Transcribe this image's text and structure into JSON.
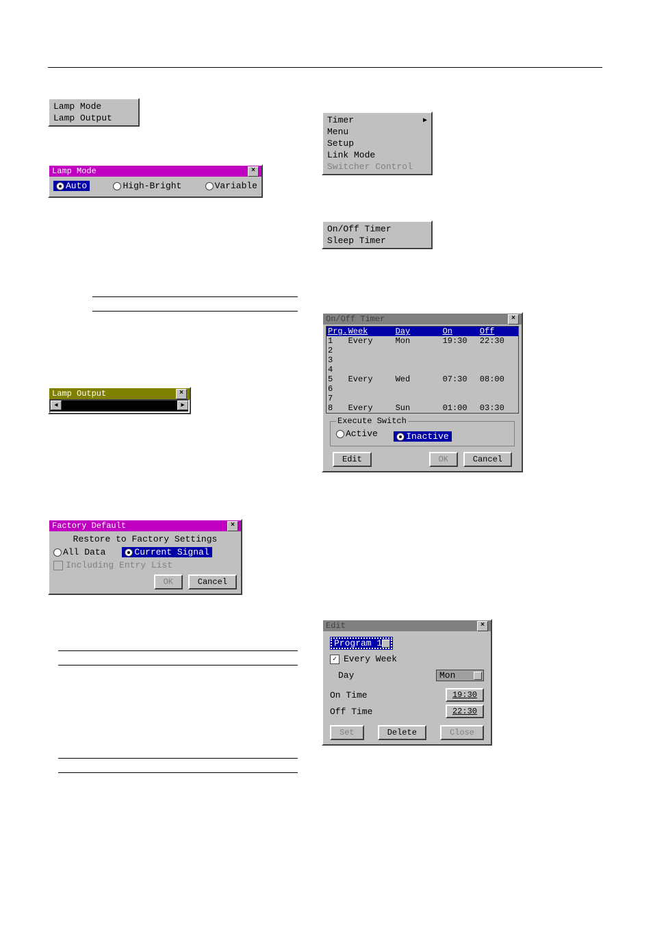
{
  "lamp_panel": {
    "mode_label": "Lamp Mode",
    "output_label": "Lamp Output"
  },
  "lamp_mode_dlg": {
    "title": "Lamp Mode",
    "opts": {
      "auto": "Auto",
      "high": "High-Bright",
      "var": "Variable"
    }
  },
  "lamp_output_dlg": {
    "title": "Lamp Output"
  },
  "factory_dlg": {
    "title": "Factory Default",
    "subtitle": "Restore to Factory Settings",
    "all": "All Data",
    "cur": "Current Signal",
    "incl": "Including Entry List",
    "ok": "OK",
    "cancel": "Cancel"
  },
  "proj_menu": {
    "timer": "Timer",
    "menu": "Menu",
    "setup": "Setup",
    "link": "Link Mode",
    "switcher": "Switcher Control"
  },
  "timer_sub": {
    "onoff": "On/Off Timer",
    "sleep": "Sleep Timer"
  },
  "onoff_dlg": {
    "title": "On/Off Timer",
    "hdr": {
      "prg": "Prg.",
      "week": "Week",
      "day": "Day",
      "on": "On",
      "off": "Off"
    },
    "rows": [
      {
        "n": "1",
        "week": "Every",
        "day": "Mon",
        "on": "19:30",
        "off": "22:30"
      },
      {
        "n": "2"
      },
      {
        "n": "3"
      },
      {
        "n": "4"
      },
      {
        "n": "5",
        "week": "Every",
        "day": "Wed",
        "on": "07:30",
        "off": "08:00"
      },
      {
        "n": "6"
      },
      {
        "n": "7"
      },
      {
        "n": "8",
        "week": "Every",
        "day": "Sun",
        "on": "01:00",
        "off": "03:30"
      }
    ],
    "exec": "Execute Switch",
    "active": "Active",
    "inactive": "Inactive",
    "edit": "Edit",
    "ok": "OK",
    "cancel": "Cancel"
  },
  "edit_dlg": {
    "title": "Edit",
    "program": "Program 1",
    "every": "Every Week",
    "day_lbl": "Day",
    "day_val": "Mon",
    "on_lbl": "On  Time",
    "on_val": "19:30",
    "off_lbl": "Off Time",
    "off_val": "22:30",
    "set": "Set",
    "del": "Delete",
    "close": "Close"
  }
}
